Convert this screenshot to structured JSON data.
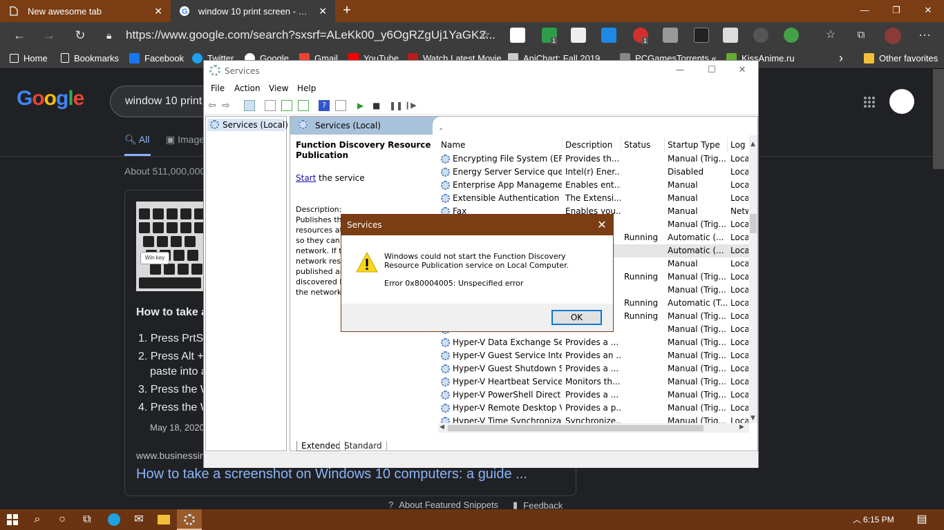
{
  "browser": {
    "tabs": [
      {
        "title": "New awesome tab"
      },
      {
        "title": "window 10 print screen - Google"
      }
    ],
    "url": "https://www.google.com/search?sxsrf=ALeKk00_y6OgRZgUj1YaGK2...",
    "bookmarks": [
      "Home",
      "Bookmarks",
      "Facebook",
      "Twitter",
      "Google",
      "Gmail",
      "YouTube",
      "Watch Latest Movie...",
      "AniChart: Fall 2019...",
      "PCGamesTorrents «...",
      "KissAnime.ru"
    ],
    "other_favorites": "Other favorites",
    "ext_badges": [
      "1",
      "1"
    ]
  },
  "google": {
    "logo": "Google",
    "query": "window 10 print",
    "tabs": [
      "All",
      "Image"
    ],
    "about": "About 511,000,000",
    "win_key": "Win key",
    "snippet_heading": "How to take a",
    "steps": [
      "1. Press PrtS",
      "2. Press Alt +",
      "paste into a",
      "3. Press the W",
      "4. Press the W"
    ],
    "date": "May 18, 2020",
    "url": "www.businessin",
    "link": "How to take a screenshot on Windows 10 computers: a guide ...",
    "footer_about": "About Featured Snippets",
    "footer_feedback": "Feedback"
  },
  "services": {
    "title": "Services",
    "menu": [
      "File",
      "Action",
      "View",
      "Help"
    ],
    "tree_item": "Services (Local)",
    "header": "Services (Local)",
    "selected_title": "Function Discovery Resource Publication",
    "start_link": "Start",
    "start_suffix": " the service",
    "desc_label": "Description:",
    "desc_lines": [
      "Publishes thi",
      "resources att",
      "so they can b",
      "network.  If t",
      "network reso",
      "published an",
      "discovered b",
      "the network."
    ],
    "columns": [
      "Name",
      "Description",
      "Status",
      "Startup Type",
      "Log"
    ],
    "rows": [
      {
        "name": "Encrypting File System (EFS)",
        "desc": "Provides th...",
        "status": "",
        "startup": "Manual (Trig...",
        "log": "Loca"
      },
      {
        "name": "Energy Server Service queen...",
        "desc": "Intel(r) Ener...",
        "status": "",
        "startup": "Disabled",
        "log": "Loca"
      },
      {
        "name": "Enterprise App Managemen...",
        "desc": "Enables ent...",
        "status": "",
        "startup": "Manual",
        "log": "Loca"
      },
      {
        "name": "Extensible Authentication P...",
        "desc": "The Extensi...",
        "status": "",
        "startup": "Manual",
        "log": "Loca"
      },
      {
        "name": "Fax",
        "desc": "Enables you...",
        "status": "",
        "startup": "Manual",
        "log": "Netw"
      },
      {
        "name": "",
        "desc": "",
        "status": "",
        "startup": "Manual (Trig...",
        "log": "Loca"
      },
      {
        "name": "",
        "desc": "",
        "status": "Running",
        "startup": "Automatic (...",
        "log": "Loca"
      },
      {
        "name": "",
        "desc": "",
        "status": "",
        "startup": "Automatic (...",
        "log": "Loca"
      },
      {
        "name": "",
        "desc": "",
        "status": "",
        "startup": "Manual",
        "log": "Loca"
      },
      {
        "name": "",
        "desc": "",
        "status": "Running",
        "startup": "Manual (Trig...",
        "log": "Loca"
      },
      {
        "name": "",
        "desc": "",
        "status": "",
        "startup": "Manual (Trig...",
        "log": "Loca"
      },
      {
        "name": "",
        "desc": "",
        "status": "Running",
        "startup": "Automatic (T...",
        "log": "Loca"
      },
      {
        "name": "",
        "desc": "",
        "status": "Running",
        "startup": "Manual (Trig...",
        "log": "Loca"
      },
      {
        "name": "",
        "desc": "",
        "status": "",
        "startup": "Manual (Trig...",
        "log": "Loca"
      },
      {
        "name": "Hyper-V Data Exchange Ser...",
        "desc": "Provides a ...",
        "status": "",
        "startup": "Manual (Trig...",
        "log": "Loca"
      },
      {
        "name": "Hyper-V Guest Service Inter...",
        "desc": "Provides an ...",
        "status": "",
        "startup": "Manual (Trig...",
        "log": "Loca"
      },
      {
        "name": "Hyper-V Guest Shutdown S...",
        "desc": "Provides a ...",
        "status": "",
        "startup": "Manual (Trig...",
        "log": "Loca"
      },
      {
        "name": "Hyper-V Heartbeat Service",
        "desc": "Monitors th...",
        "status": "",
        "startup": "Manual (Trig...",
        "log": "Loca"
      },
      {
        "name": "Hyper-V PowerShell Direct ...",
        "desc": "Provides a ...",
        "status": "",
        "startup": "Manual (Trig...",
        "log": "Loca"
      },
      {
        "name": "Hyper-V Remote Desktop Vi...",
        "desc": "Provides a p...",
        "status": "",
        "startup": "Manual (Trig...",
        "log": "Loca"
      },
      {
        "name": "Hyper-V Time Synchronizati...",
        "desc": "Synchronize...",
        "status": "",
        "startup": "Manual (Trig...",
        "log": "Loca"
      }
    ],
    "view_tabs": [
      "Extended",
      "Standard"
    ]
  },
  "dialog": {
    "title": "Services",
    "message": "Windows could not start the Function Discovery Resource Publication service on Local Computer.",
    "error": "Error 0x80004005: Unspecified error",
    "ok": "OK"
  },
  "taskbar": {
    "time": "6:15 PM"
  },
  "colors": {
    "accent": "#7a3d14",
    "chrome_dark": "#3c3c3c",
    "google_bg": "#202124",
    "link": "#8ab4f8"
  }
}
